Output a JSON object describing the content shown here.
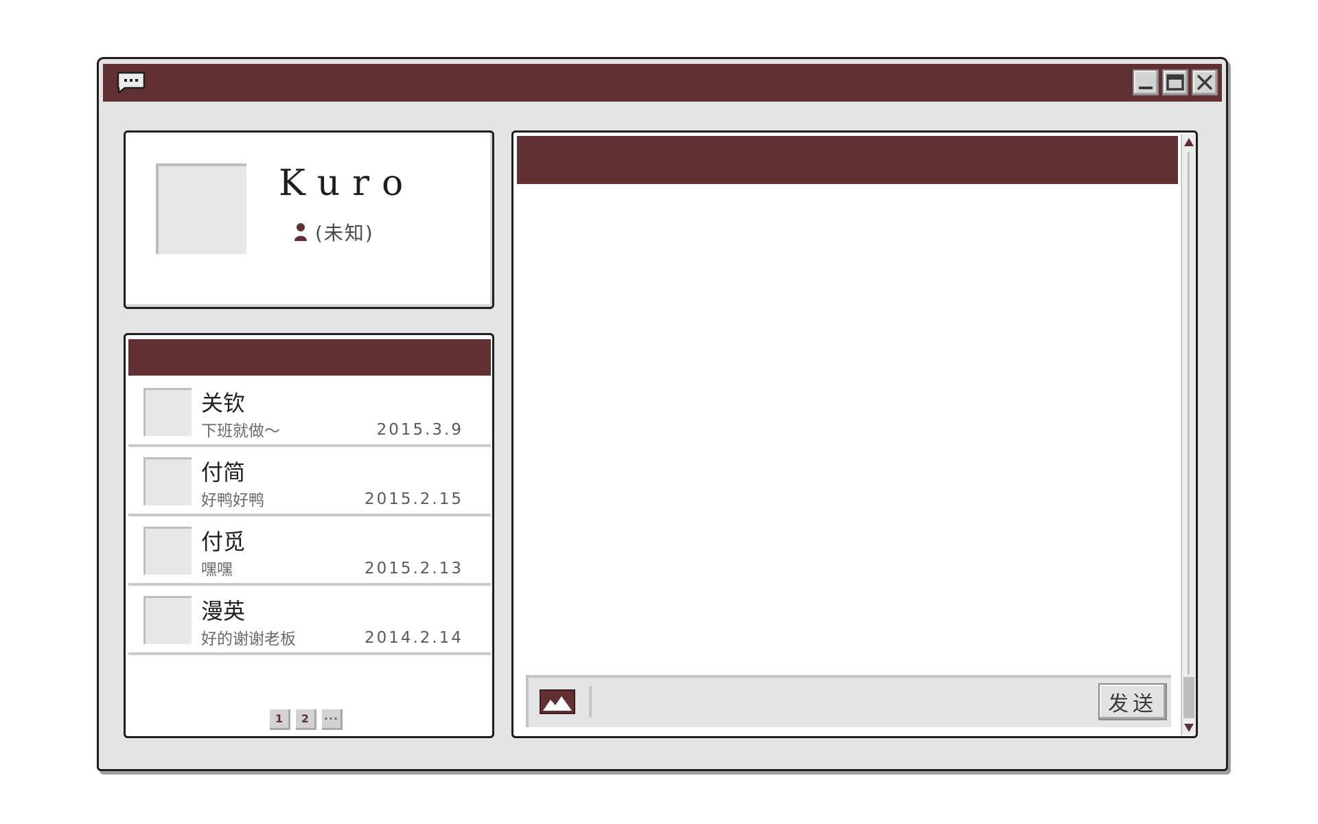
{
  "window": {
    "titlebar_color": "#623032",
    "app_icon": "chat-bubble-icon",
    "controls": [
      "minimize-icon",
      "maximize-icon",
      "close-icon"
    ]
  },
  "profile": {
    "name": "Kuro",
    "gender_icon": "user-icon",
    "gender": "(未知)"
  },
  "contacts": [
    {
      "name": "关钦",
      "message": "下班就做～",
      "date": "2015.3.9"
    },
    {
      "name": "付简",
      "message": "好鸭好鸭",
      "date": "2015.2.15"
    },
    {
      "name": "付觅",
      "message": "嘿嘿",
      "date": "2015.2.13"
    },
    {
      "name": "漫英",
      "message": "好的谢谢老板",
      "date": "2014.2.14"
    }
  ],
  "pagination": {
    "pages": [
      "1",
      "2"
    ],
    "more": "···"
  },
  "chat": {
    "image_button_icon": "image-icon",
    "message_value": "",
    "send_label": "发送"
  }
}
